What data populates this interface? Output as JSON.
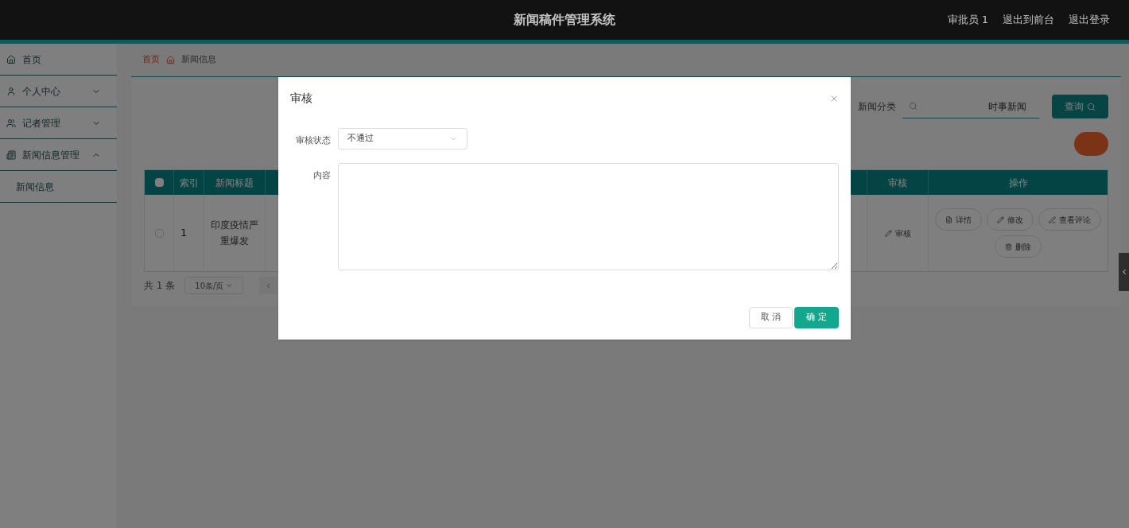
{
  "header": {
    "title": "新闻稿件管理系统",
    "links": [
      "审批员 1",
      "退出到前台",
      "退出登录"
    ]
  },
  "sidebar": {
    "items": [
      {
        "label": "首页"
      },
      {
        "label": "个人中心",
        "expanded": false
      },
      {
        "label": "记者管理",
        "expanded": false
      },
      {
        "label": "新闻信息管理",
        "expanded": true,
        "children": [
          {
            "label": "新闻信息"
          }
        ]
      }
    ]
  },
  "breadcrumb": [
    "首页",
    "新闻信息"
  ],
  "search": {
    "label": "新闻分类",
    "value": "时事新闻",
    "button": "查询"
  },
  "table": {
    "all_selected": false,
    "columns": [
      "索引",
      "新闻标题",
      "审核",
      "操作"
    ],
    "rows": [
      {
        "selected": false,
        "index": "1",
        "title": "印度疫情严重爆发",
        "review": "审核",
        "actions": [
          "详情",
          "修改",
          "查看评论",
          "删除"
        ]
      }
    ]
  },
  "pagination": {
    "total": "共 1 条",
    "page_size": "10条/页"
  },
  "dialog": {
    "title": "审核",
    "fields": [
      {
        "kind": "select",
        "label": "审核状态",
        "value": "不通过"
      },
      {
        "kind": "textarea",
        "label": "内容"
      }
    ],
    "buttons": [
      {
        "label": "取 消",
        "primary": false
      },
      {
        "label": "确 定",
        "primary": true
      }
    ]
  }
}
